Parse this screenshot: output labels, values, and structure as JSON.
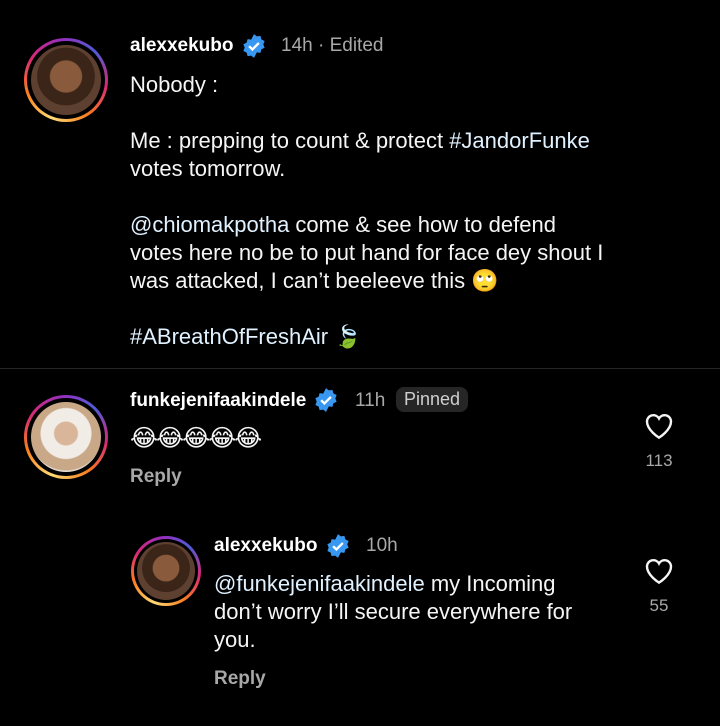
{
  "post": {
    "username": "alexxekubo",
    "meta": "14h · Edited",
    "line1": "Nobody :",
    "line2_prefix": "Me : prepping to count & protect ",
    "line2_tag": "#JandorFunke",
    "line2_suffix": "votes tomorrow.",
    "mention": "@chiomakpotha",
    "line3_rest": " come & see how to defend",
    "line3b": "votes here no be to put hand for face dey shout I",
    "line3c": "was attacked, I can’t beeleeve this 🙄",
    "hashtag": "#ABreathOfFreshAir",
    "hashtag_emoji": "🍃"
  },
  "comment": {
    "username": "funkejenifaakindele",
    "time": "11h",
    "badge": "Pinned",
    "text": "😂😂😂😂😂",
    "reply_label": "Reply",
    "likes": "113"
  },
  "reply": {
    "username": "alexxekubo",
    "time": "10h",
    "mention": "@funkejenifaakindele",
    "text_rest": " my Incoming",
    "line2": "don’t worry I’ll secure everywhere for",
    "line3": "you.",
    "reply_label": "Reply",
    "likes": "55"
  },
  "colors": {
    "verified": "#3897f0",
    "background": "#000000",
    "muted": "#a8a8a8"
  }
}
